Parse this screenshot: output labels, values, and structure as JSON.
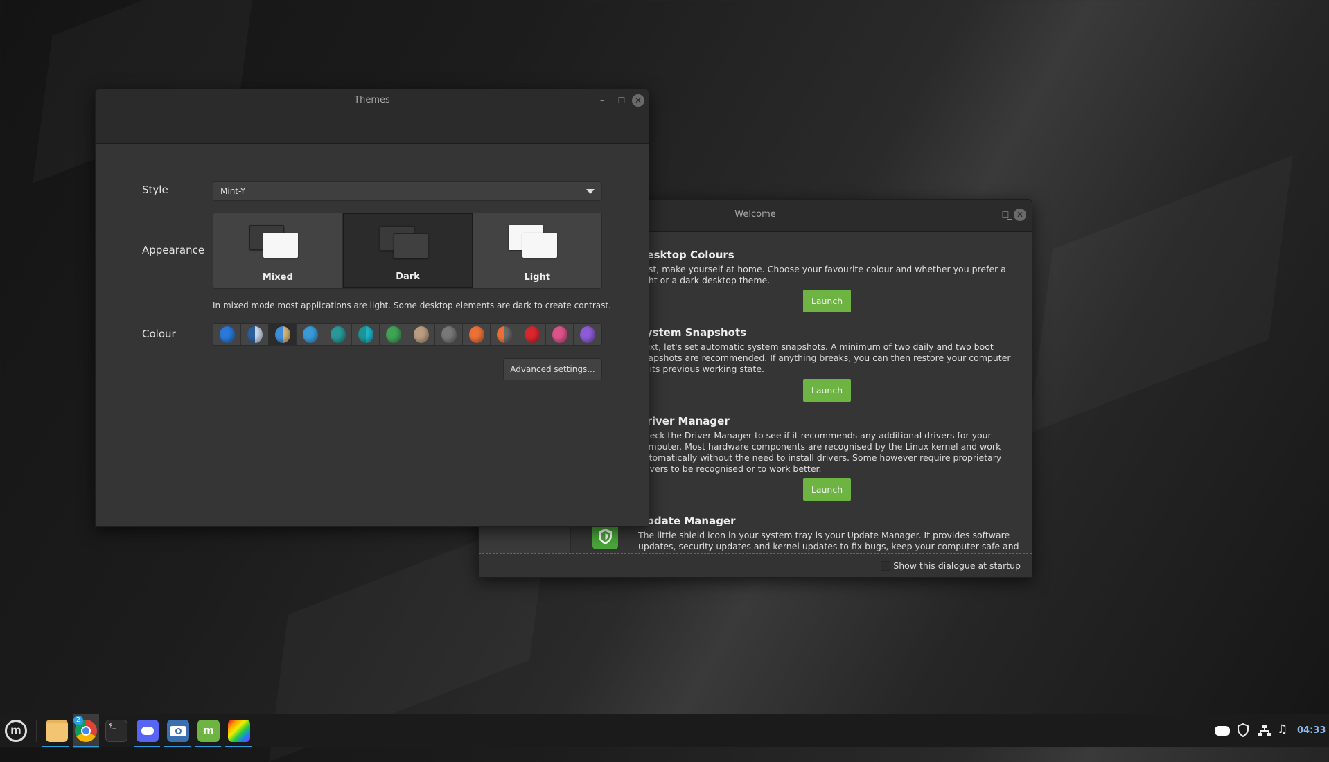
{
  "themes_window": {
    "title": "Themes",
    "style_label": "Style",
    "style_value": "Mint-Y",
    "appearance_label": "Appearance",
    "appearance_options": [
      {
        "label": "Mixed",
        "selected": false
      },
      {
        "label": "Dark",
        "selected": true
      },
      {
        "label": "Light",
        "selected": false
      }
    ],
    "description": "In mixed mode most applications are light. Some desktop elements are dark to create contrast.",
    "colour_label": "Colour",
    "colours": [
      {
        "name": "blue",
        "c1": "#2a78d8",
        "c2": "#2a78d8"
      },
      {
        "name": "blue-white",
        "c1": "#2d5f9a",
        "c2": "#c9d8e8"
      },
      {
        "name": "blue-sand",
        "c1": "#3d8ed8",
        "c2": "#d9b376",
        "selected": true
      },
      {
        "name": "aqua",
        "c1": "#3a9ad6",
        "c2": "#3a9ad6"
      },
      {
        "name": "teal",
        "c1": "#2a9898",
        "c2": "#2a9898"
      },
      {
        "name": "cyan",
        "c1": "#1f9494",
        "c2": "#20b4c8"
      },
      {
        "name": "green",
        "c1": "#3fa455",
        "c2": "#3fa455"
      },
      {
        "name": "sand",
        "c1": "#b99d80",
        "c2": "#b99d80"
      },
      {
        "name": "grey",
        "c1": "#787878",
        "c2": "#787878"
      },
      {
        "name": "orange",
        "c1": "#ea7038",
        "c2": "#ea7038"
      },
      {
        "name": "orange-grey",
        "c1": "#ea7038",
        "c2": "#6b6b6b"
      },
      {
        "name": "red",
        "c1": "#d8272e",
        "c2": "#d8272e"
      },
      {
        "name": "pink",
        "c1": "#d9548a",
        "c2": "#d9548a"
      },
      {
        "name": "purple",
        "c1": "#8d5bd6",
        "c2": "#8d5bd6"
      }
    ],
    "advanced_button": "Advanced settings..."
  },
  "welcome_window": {
    "title": "Welcome",
    "sections": [
      {
        "heading": "Desktop Colours",
        "body": "First, make yourself at home. Choose your favourite colour and whether you prefer a light or a dark desktop theme.",
        "button": "Launch"
      },
      {
        "heading": "System Snapshots",
        "body": "Next, let's set automatic system snapshots. A minimum of two daily and two boot snapshots are recommended. If anything breaks, you can then restore your computer to its previous working state.",
        "button": "Launch"
      },
      {
        "heading": "Driver Manager",
        "body": "Check the Driver Manager to see if it recommends any additional drivers for your computer. Most hardware components are recognised by the Linux kernel and work automatically without the need to install drivers. Some however require proprietary drivers to be recognised or to work better.",
        "button": "Launch"
      },
      {
        "heading": "Update Manager",
        "body": "The little shield icon in your system tray is your Update Manager. It provides software updates, security updates and kernel updates to fix bugs, keep your computer safe and"
      }
    ],
    "startup_checkbox": {
      "label": "Show this dialogue at startup",
      "checked": false
    }
  },
  "taskbar": {
    "apps": [
      "menu-icon",
      "files-icon",
      "chrome-icon",
      "terminal-icon",
      "discord-icon",
      "screenshot-icon",
      "mintinstall-icon",
      "drawing-icon"
    ],
    "chrome_badge": "2",
    "terminal_glyph": "$_",
    "tray": [
      "discord-icon",
      "shield-icon",
      "network-icon",
      "sound-icon"
    ],
    "clock": "04:33",
    "clock_color": "#8ab8e8",
    "accent": "#2e9ce0"
  }
}
